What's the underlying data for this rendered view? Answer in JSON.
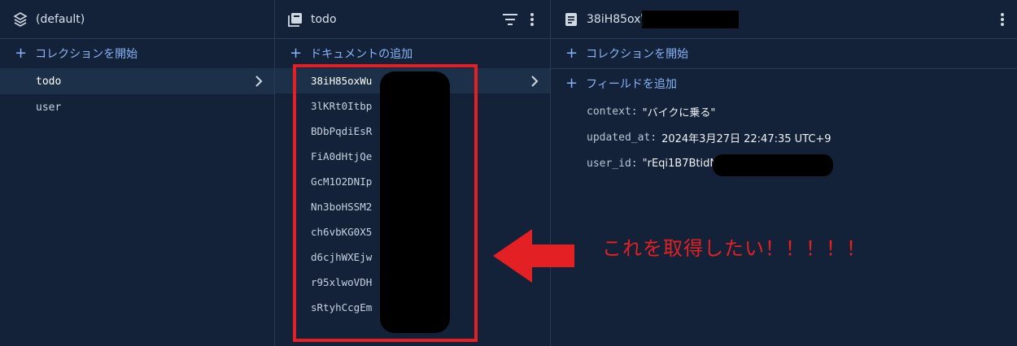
{
  "root_panel": {
    "title": "(default)",
    "add_label": "コレクションを開始",
    "collections": [
      {
        "label": "todo",
        "selected": true
      },
      {
        "label": "user",
        "selected": false
      }
    ]
  },
  "collection_panel": {
    "title": "todo",
    "add_label": "ドキュメントの追加",
    "documents": [
      {
        "id": "38iH85oxWu",
        "selected": true
      },
      {
        "id": "3lKRt0Itbp"
      },
      {
        "id": "BDbPqdiEsR"
      },
      {
        "id": "FiA0dHtjQe"
      },
      {
        "id": "GcM1O2DNIp"
      },
      {
        "id": "Nn3boHSSM2"
      },
      {
        "id": "ch6vbKG0X5"
      },
      {
        "id": "d6cjhWXEjw"
      },
      {
        "id": "r95xlwoVDH"
      },
      {
        "id": "sRtyhCcgEm"
      }
    ]
  },
  "document_panel": {
    "title": "38iH85oxW",
    "add_collection_label": "コレクションを開始",
    "add_field_label": "フィールドを追加",
    "fields": [
      {
        "key": "context:",
        "value": "\"バイクに乗る\""
      },
      {
        "key": "updated_at:",
        "value": "2024年3月27日 22:47:35 UTC+9"
      },
      {
        "key": "user_id:",
        "value": "\"rEqi1B7BtidN"
      }
    ]
  },
  "annotation": {
    "text": "これを取得したい！！！！！",
    "color": "#e32124"
  },
  "theme": {
    "background": "#132238",
    "accent": "#8ab4f8",
    "selected_row": "#1d3049"
  }
}
